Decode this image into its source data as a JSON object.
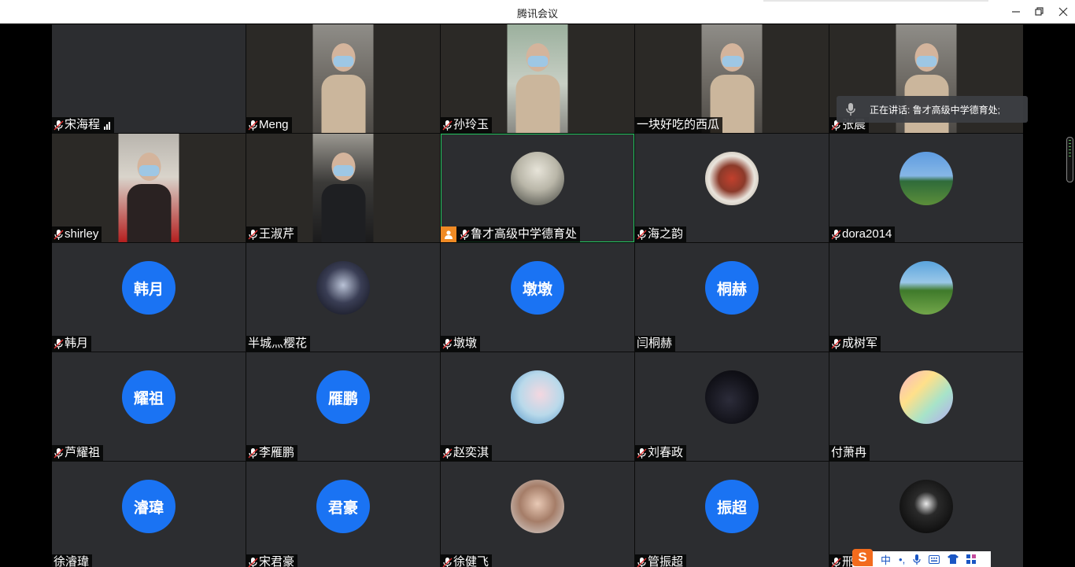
{
  "window": {
    "title": "腾讯会议"
  },
  "speaking": {
    "text": "正在讲话: 鲁才高级中学德育处;"
  },
  "ime": {
    "lang": "中",
    "punct": "•,"
  },
  "colors": {
    "accent": "#1a73f3",
    "host": "#f08a24",
    "active_border": "#22c55e"
  },
  "participants": [
    {
      "name": "宋海程",
      "mic": true,
      "signal": true,
      "kind": "empty"
    },
    {
      "name": "Meng",
      "mic": true,
      "kind": "video"
    },
    {
      "name": "孙玲玉",
      "mic": true,
      "kind": "video"
    },
    {
      "name": "一块好吃的西瓜",
      "mic": false,
      "kind": "video"
    },
    {
      "name": "张晨",
      "mic": true,
      "kind": "video"
    },
    {
      "name": "shirley",
      "mic": true,
      "kind": "video"
    },
    {
      "name": "王淑芹",
      "mic": true,
      "kind": "video"
    },
    {
      "name": "鲁才高级中学德育处",
      "mic": true,
      "host": true,
      "active": true,
      "kind": "photo",
      "icon": "school-gate-photo"
    },
    {
      "name": "海之韵",
      "mic": true,
      "kind": "photo",
      "icon": "tea-set-photo"
    },
    {
      "name": "dora2014",
      "mic": true,
      "kind": "photo",
      "icon": "child-playground-photo"
    },
    {
      "name": "韩月",
      "mic": true,
      "kind": "text",
      "avatar_text": "韩月"
    },
    {
      "name": "半城灬樱花",
      "mic": false,
      "kind": "photo",
      "icon": "portrait-photo"
    },
    {
      "name": "墩墩",
      "mic": true,
      "kind": "text",
      "avatar_text": "墩墩"
    },
    {
      "name": "闫桐赫",
      "mic": false,
      "kind": "text",
      "avatar_text": "桐赫"
    },
    {
      "name": "成树军",
      "mic": true,
      "kind": "photo",
      "icon": "landscape-photo"
    },
    {
      "name": "芦耀祖",
      "mic": true,
      "kind": "text",
      "avatar_text": "耀祖"
    },
    {
      "name": "李雁鹏",
      "mic": true,
      "kind": "text",
      "avatar_text": "雁鹏"
    },
    {
      "name": "赵奕淇",
      "mic": true,
      "kind": "photo",
      "icon": "anime-girl-photo"
    },
    {
      "name": "刘春政",
      "mic": true,
      "kind": "photo",
      "icon": "dark-portrait-photo"
    },
    {
      "name": "付萧冉",
      "mic": false,
      "kind": "photo",
      "icon": "cartoon-girl-photo"
    },
    {
      "name": "徐濬瑋",
      "mic": false,
      "kind": "text",
      "avatar_text": "濬瑋"
    },
    {
      "name": "宋君豪",
      "mic": true,
      "kind": "text",
      "avatar_text": "君豪"
    },
    {
      "name": "徐健飞",
      "mic": true,
      "kind": "photo",
      "icon": "girl-portrait-photo"
    },
    {
      "name": "管振超",
      "mic": true,
      "kind": "text",
      "avatar_text": "振超"
    },
    {
      "name": "邢腾",
      "mic": true,
      "kind": "photo",
      "icon": "silhouette-photo"
    }
  ]
}
